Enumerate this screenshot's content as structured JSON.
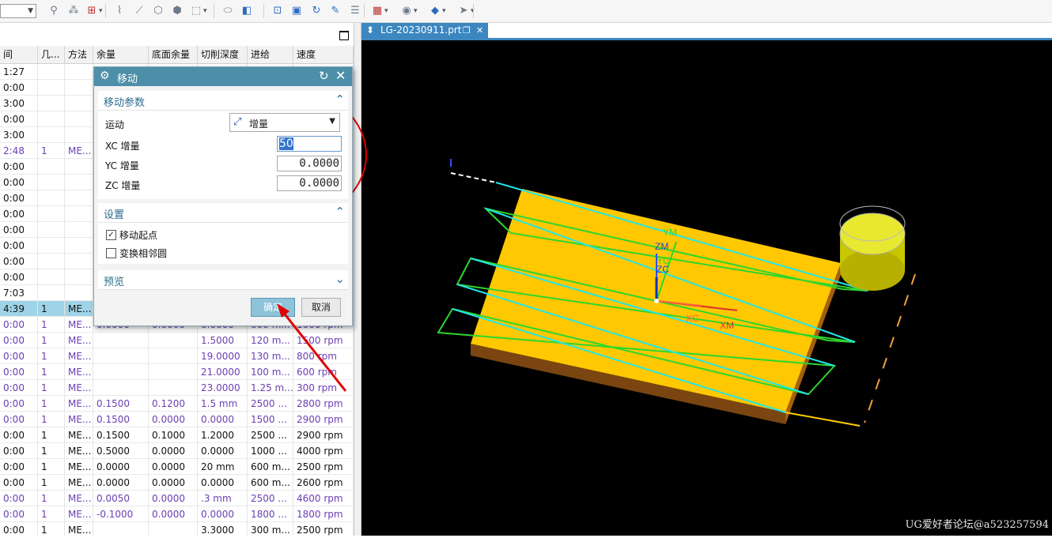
{
  "toolbar": {
    "combo_value": "",
    "icons": [
      "select-filter-icon",
      "snap-icon",
      "point-dropdown-icon",
      "curve-icon",
      "line-icon",
      "circle-icon",
      "polygon-icon",
      "box-select-icon",
      "block-icon",
      "cube-icon",
      "refresh-view-icon",
      "image-icon",
      "rotate-icon",
      "brush-icon",
      "layers-icon",
      "grid-icon",
      "render-icon",
      "shade-icon",
      "arrow-icon"
    ]
  },
  "navigator": {
    "columns": [
      "间",
      "几...",
      "方法",
      "余量",
      "底面余量",
      "切削深度",
      "进给",
      "速度"
    ],
    "rows": [
      {
        "time": "1:27",
        "geom": "",
        "method": "",
        "stock": "",
        "floor": "",
        "depth": "",
        "feed": "",
        "speed": "",
        "style": "black"
      },
      {
        "time": "0:00",
        "geom": "",
        "method": "",
        "stock": "",
        "floor": "",
        "depth": "",
        "feed": "",
        "speed": "",
        "style": "black"
      },
      {
        "time": "3:00",
        "geom": "",
        "method": "",
        "stock": "",
        "floor": "",
        "depth": "",
        "feed": "",
        "speed": "",
        "style": "black"
      },
      {
        "time": "0:00",
        "geom": "",
        "method": "",
        "stock": "",
        "floor": "",
        "depth": "",
        "feed": "",
        "speed": "",
        "style": "black"
      },
      {
        "time": "3:00",
        "geom": "",
        "method": "",
        "stock": "",
        "floor": "",
        "depth": "",
        "feed": "",
        "speed": "",
        "style": "black"
      },
      {
        "time": "2:48",
        "geom": "1",
        "method": "ME...",
        "stock": "",
        "floor": "",
        "depth": "",
        "feed": "",
        "speed": "",
        "style": "purple"
      },
      {
        "time": "0:00",
        "geom": "",
        "method": "",
        "stock": "",
        "floor": "",
        "depth": "",
        "feed": "",
        "speed": "",
        "style": "black"
      },
      {
        "time": "0:00",
        "geom": "",
        "method": "",
        "stock": "",
        "floor": "",
        "depth": "",
        "feed": "",
        "speed": "",
        "style": "black"
      },
      {
        "time": "0:00",
        "geom": "",
        "method": "",
        "stock": "",
        "floor": "",
        "depth": "",
        "feed": "",
        "speed": "",
        "style": "black"
      },
      {
        "time": "0:00",
        "geom": "",
        "method": "",
        "stock": "",
        "floor": "",
        "depth": "",
        "feed": "",
        "speed": "",
        "style": "black"
      },
      {
        "time": "0:00",
        "geom": "",
        "method": "",
        "stock": "",
        "floor": "",
        "depth": "",
        "feed": "",
        "speed": "",
        "style": "black"
      },
      {
        "time": "0:00",
        "geom": "",
        "method": "",
        "stock": "",
        "floor": "",
        "depth": "",
        "feed": "",
        "speed": "",
        "style": "black"
      },
      {
        "time": "0:00",
        "geom": "",
        "method": "",
        "stock": "",
        "floor": "",
        "depth": "",
        "feed": "",
        "speed": "",
        "style": "black"
      },
      {
        "time": "0:00",
        "geom": "",
        "method": "",
        "stock": "",
        "floor": "",
        "depth": "",
        "feed": "",
        "speed": "",
        "style": "black"
      },
      {
        "time": "7:03",
        "geom": "",
        "method": "",
        "stock": "",
        "floor": "",
        "depth": "",
        "feed": "",
        "speed": "",
        "style": "black"
      },
      {
        "time": "4:39",
        "geom": "1",
        "method": "ME...",
        "stock": "",
        "floor": "",
        "depth": "",
        "feed": "",
        "speed": "",
        "style": "sel"
      },
      {
        "time": "0:00",
        "geom": "1",
        "method": "ME...",
        "stock": "0.0000",
        "floor": "0.0000",
        "depth": "0.0000",
        "feed": "600 m...",
        "speed": "1000 rpm",
        "style": "purple"
      },
      {
        "time": "0:00",
        "geom": "1",
        "method": "ME...",
        "stock": "",
        "floor": "",
        "depth": "1.5000",
        "feed": "120 m...",
        "speed": "1500 rpm",
        "style": "purple"
      },
      {
        "time": "0:00",
        "geom": "1",
        "method": "ME...",
        "stock": "",
        "floor": "",
        "depth": "19.0000",
        "feed": "130 m...",
        "speed": "800 rpm",
        "style": "purple"
      },
      {
        "time": "0:00",
        "geom": "1",
        "method": "ME...",
        "stock": "",
        "floor": "",
        "depth": "21.0000",
        "feed": "100 m...",
        "speed": "600 rpm",
        "style": "purple"
      },
      {
        "time": "0:00",
        "geom": "1",
        "method": "ME...",
        "stock": "",
        "floor": "",
        "depth": "23.0000",
        "feed": "1.25 m...",
        "speed": "300 rpm",
        "style": "purple"
      },
      {
        "time": "0:00",
        "geom": "1",
        "method": "ME...",
        "stock": "0.1500",
        "floor": "0.1200",
        "depth": "1.5 mm",
        "feed": "2500 ...",
        "speed": "2800 rpm",
        "style": "purple"
      },
      {
        "time": "0:00",
        "geom": "1",
        "method": "ME...",
        "stock": "0.1500",
        "floor": "0.0000",
        "depth": "0.0000",
        "feed": "1500 ...",
        "speed": "2900 rpm",
        "style": "purple"
      },
      {
        "time": "0:00",
        "geom": "1",
        "method": "ME...",
        "stock": "0.1500",
        "floor": "0.1000",
        "depth": "1.2000",
        "feed": "2500 ...",
        "speed": "2900 rpm",
        "style": "black"
      },
      {
        "time": "0:00",
        "geom": "1",
        "method": "ME...",
        "stock": "0.5000",
        "floor": "0.0000",
        "depth": "0.0000",
        "feed": "1000 ...",
        "speed": "4000 rpm",
        "style": "black"
      },
      {
        "time": "0:00",
        "geom": "1",
        "method": "ME...",
        "stock": "0.0000",
        "floor": "0.0000",
        "depth": "20 mm",
        "feed": "600 m...",
        "speed": "2500 rpm",
        "style": "black"
      },
      {
        "time": "0:00",
        "geom": "1",
        "method": "ME...",
        "stock": "0.0000",
        "floor": "0.0000",
        "depth": "0.0000",
        "feed": "600 m...",
        "speed": "2600 rpm",
        "style": "black"
      },
      {
        "time": "0:00",
        "geom": "1",
        "method": "ME...",
        "stock": "0.0050",
        "floor": "0.0000",
        "depth": ".3 mm",
        "feed": "2500 ...",
        "speed": "4600 rpm",
        "style": "purple"
      },
      {
        "time": "0:00",
        "geom": "1",
        "method": "ME...",
        "stock": "-0.1000",
        "floor": "0.0000",
        "depth": "0.0000",
        "feed": "1800 ...",
        "speed": "1800 rpm",
        "style": "purple"
      },
      {
        "time": "0:00",
        "geom": "1",
        "method": "ME...",
        "stock": "",
        "floor": "",
        "depth": "3.3000",
        "feed": "300 m...",
        "speed": "2500 rpm",
        "style": "black"
      }
    ]
  },
  "graphics": {
    "tab_label": "LG-20230911.prt",
    "axis_labels": {
      "ym": "YM",
      "zm": "ZM",
      "yc": "YC",
      "zc": "ZC",
      "xc": "XC",
      "xm": "XM"
    },
    "watermark": "UG爱好者论坛@a523257594"
  },
  "dialog": {
    "title": "移动",
    "section_params": "移动参数",
    "motion_label": "运动",
    "motion_value": "增量",
    "xc_label": "XC 增量",
    "xc_value": "50",
    "yc_label": "YC 增量",
    "yc_value": "0.0000",
    "zc_label": "ZC 增量",
    "zc_value": "0.0000",
    "section_settings": "设置",
    "move_start_label": "移动起点",
    "move_start_checked": true,
    "swap_adjacent_label": "变换相邻圆",
    "swap_adjacent_checked": false,
    "section_preview": "预览",
    "ok_label": "确定",
    "cancel_label": "取消"
  },
  "colors": {
    "dialog_title": "#4d8fa8",
    "tab_active": "#3c87c0",
    "part_top": "#ffc800",
    "toolpath_cyan": "#22e6e6",
    "toolpath_green": "#2ed62e",
    "annotation_red": "#e00000"
  }
}
